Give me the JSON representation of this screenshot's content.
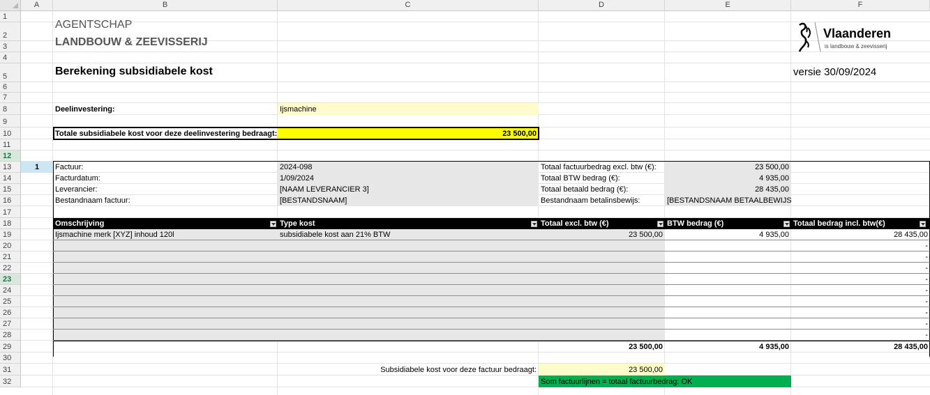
{
  "columns": [
    "A",
    "B",
    "C",
    "D",
    "E",
    "F"
  ],
  "rows": [
    "1",
    "2",
    "3",
    "4",
    "5",
    "6",
    "7",
    "8",
    "9",
    "10",
    "11",
    "12",
    "13",
    "14",
    "15",
    "16",
    "17",
    "18",
    "19",
    "20",
    "21",
    "22",
    "23",
    "24",
    "25",
    "26",
    "27",
    "28",
    "29",
    "30",
    "31",
    "32"
  ],
  "header": {
    "agency": "AGENTSCHAP",
    "department": "LANDBOUW & ZEEVISSERIJ",
    "title": "Berekening subsidiabele kost",
    "version": "versie 30/09/2024",
    "logo_name": "Vlaanderen",
    "logo_tagline": "is landbouw & zeevisserij"
  },
  "investment": {
    "label": "Deelinvestering:",
    "value": "Ijsmachine",
    "total_label": "Totale subsidiabele kost voor deze deelinvestering bedraagt:",
    "total_value": "23 500,00"
  },
  "invoice": {
    "number": "1",
    "factuur_label": "Factuur:",
    "factuur_value": "2024-098",
    "datum_label": "Facturdatum:",
    "datum_value": "1/09/2024",
    "leverancier_label": "Leverancier:",
    "leverancier_value": "[NAAM LEVERANCIER 3]",
    "bestand_label": "Bestandnaam factuur:",
    "bestand_value": "[BESTANDSNAAM]",
    "excl_label": "Totaal factuurbedrag excl. btw (€):",
    "excl_value": "23 500,00",
    "btw_label": "Totaal BTW bedrag (€):",
    "btw_value": "4 935,00",
    "betaald_label": "Totaal betaald bedrag (€):",
    "betaald_value": "28 435,00",
    "betaal_bestand_label": "Bestandnaam betalinsbewijs:",
    "betaal_bestand_value": "[BESTANDSNAAM BETAALBEWIJS]"
  },
  "table": {
    "headers": [
      "Omschrijving",
      "Type kost",
      "Totaal excl. btw (€)",
      "BTW bedrag (€)",
      "Totaal bedrag incl. btw(€)"
    ],
    "rows": [
      [
        "Ijsmachine merk [XYZ] inhoud 120l",
        "subsidiabele kost aan 21% BTW",
        "23 500,00",
        "4 935,00",
        "28 435,00"
      ],
      [
        "",
        "",
        "",
        "",
        "-"
      ],
      [
        "",
        "",
        "",
        "",
        "-"
      ],
      [
        "",
        "",
        "",
        "",
        "-"
      ],
      [
        "",
        "",
        "",
        "",
        "-"
      ],
      [
        "",
        "",
        "",
        "",
        "-"
      ],
      [
        "",
        "",
        "",
        "",
        "-"
      ],
      [
        "",
        "",
        "",
        "",
        "-"
      ],
      [
        "",
        "",
        "",
        "",
        "-"
      ],
      [
        "",
        "",
        "",
        "",
        "-"
      ]
    ],
    "totals": [
      "23 500,00",
      "4 935,00",
      "28 435,00"
    ]
  },
  "summary": {
    "label": "Subsidiabele kost voor deze factuur bedraagt:",
    "value": "23 500,00",
    "check": "Som factuurlijnen = totaal factuurbedrag: OK"
  },
  "colors": {
    "yellow": "#ffff00",
    "cream": "#fffccc",
    "green": "#00b050",
    "grey_fill": "#e7e7e7",
    "header_fill": "#000000"
  }
}
